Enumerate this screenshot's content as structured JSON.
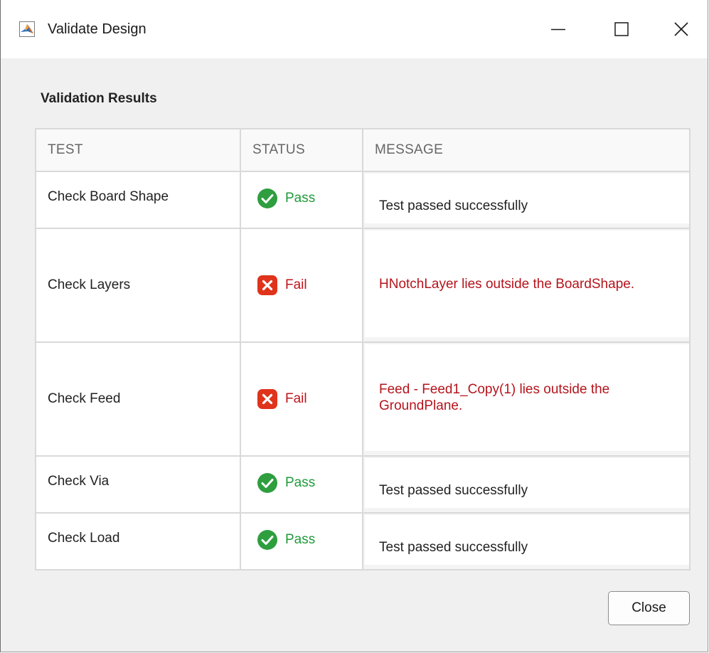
{
  "window": {
    "title": "Validate Design",
    "app_icon": "matlab-icon",
    "controls": {
      "minimize_icon": "minimize-icon",
      "maximize_icon": "maximize-icon",
      "close_icon": "close-icon"
    }
  },
  "section_title": "Validation Results",
  "table": {
    "headers": {
      "test": "TEST",
      "status": "STATUS",
      "message": "MESSAGE"
    },
    "rows": [
      {
        "test": "Check Board Shape",
        "status": "Pass",
        "status_icon": "check-circle-icon",
        "message": "Test passed successfully",
        "message_kind": "ok"
      },
      {
        "test": "Check Layers",
        "status": "Fail",
        "status_icon": "x-square-icon",
        "message": "HNotchLayer lies outside the BoardShape.",
        "message_kind": "error"
      },
      {
        "test": "Check Feed",
        "status": "Fail",
        "status_icon": "x-square-icon",
        "message": "Feed - Feed1_Copy(1) lies outside the GroundPlane.",
        "message_kind": "error"
      },
      {
        "test": "Check Via",
        "status": "Pass",
        "status_icon": "check-circle-icon",
        "message": "Test passed successfully",
        "message_kind": "ok"
      },
      {
        "test": "Check Load",
        "status": "Pass",
        "status_icon": "check-circle-icon",
        "message": "Test passed successfully",
        "message_kind": "ok"
      }
    ]
  },
  "close_button_label": "Close",
  "colors": {
    "pass": "#1f9b3a",
    "fail": "#c0141c",
    "error_text": "#b5141c",
    "header_text": "#666666"
  }
}
